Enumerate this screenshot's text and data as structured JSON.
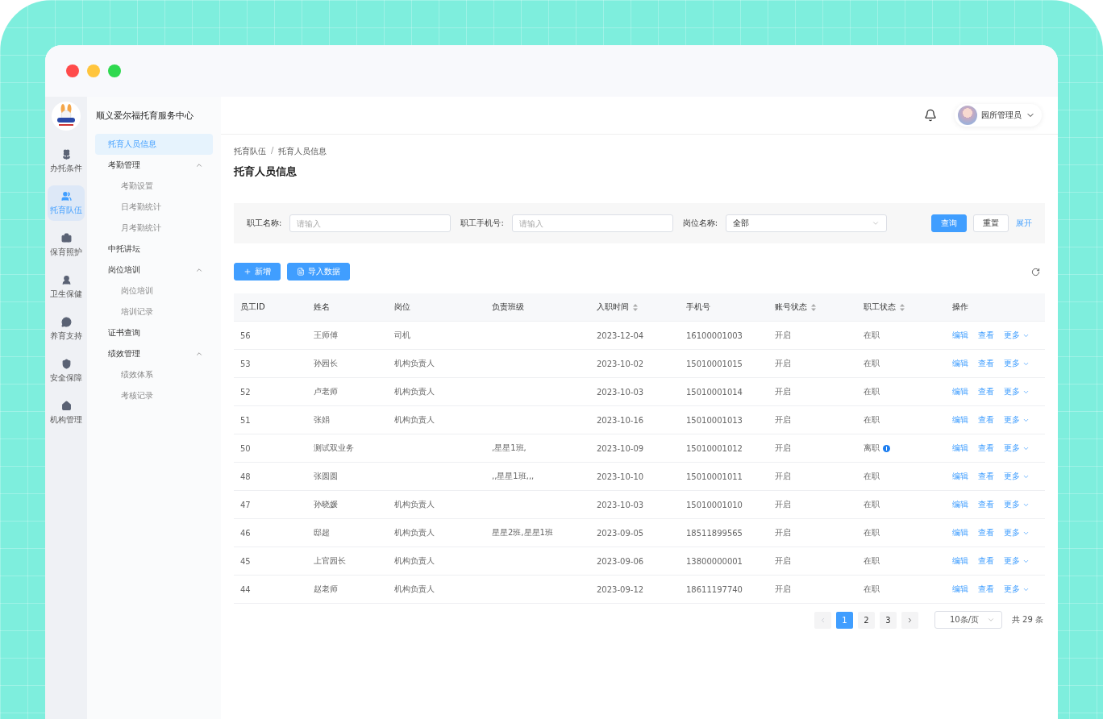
{
  "rail": [
    {
      "label": "办托条件",
      "selected": false
    },
    {
      "label": "托育队伍",
      "selected": true
    },
    {
      "label": "保育照护",
      "selected": false
    },
    {
      "label": "卫生保健",
      "selected": false
    },
    {
      "label": "养育支持",
      "selected": false
    },
    {
      "label": "安全保障",
      "selected": false
    },
    {
      "label": "机构管理",
      "selected": false
    }
  ],
  "org_title": "顺义爱尔福托育服务中心",
  "nav": [
    {
      "label": "托育人员信息",
      "selected": true
    },
    {
      "label": "考勤管理",
      "expanded": true,
      "selected": false,
      "children": [
        {
          "label": "考勤设置",
          "selected": false
        },
        {
          "label": "日考勤统计",
          "selected": false
        },
        {
          "label": "月考勤统计",
          "selected": false
        }
      ]
    },
    {
      "label": "中托讲坛",
      "selected": false
    },
    {
      "label": "岗位培训",
      "expanded": true,
      "selected": false,
      "children": [
        {
          "label": "岗位培训",
          "selected": false
        },
        {
          "label": "培训记录",
          "selected": false
        }
      ]
    },
    {
      "label": "证书查询",
      "selected": false
    },
    {
      "label": "绩效管理",
      "expanded": true,
      "selected": false,
      "children": [
        {
          "label": "绩效体系",
          "selected": false
        },
        {
          "label": "考核记录",
          "selected": false
        }
      ]
    }
  ],
  "user": {
    "name": "园所管理员"
  },
  "breadcrumb": [
    "托育队伍",
    "/",
    "托育人员信息"
  ],
  "page_title": "托育人员信息",
  "filters": [
    {
      "label": "职工名称:",
      "kind": "input",
      "placeholder": "请输入"
    },
    {
      "label": "职工手机号:",
      "kind": "input",
      "placeholder": "请输入"
    },
    {
      "label": "岗位名称:",
      "kind": "select",
      "value": "全部"
    }
  ],
  "filter_buttons": {
    "query": "查询",
    "reset": "重置",
    "expand": "展开"
  },
  "toolbar": {
    "add": "新增",
    "import": "导入数据"
  },
  "table": {
    "columns": [
      {
        "label": "员工ID",
        "sortable": false
      },
      {
        "label": "姓名",
        "sortable": false
      },
      {
        "label": "岗位",
        "sortable": false
      },
      {
        "label": "负责班级",
        "sortable": false
      },
      {
        "label": "入职时间",
        "sortable": true
      },
      {
        "label": "手机号",
        "sortable": false
      },
      {
        "label": "账号状态",
        "sortable": true
      },
      {
        "label": "职工状态",
        "sortable": true
      },
      {
        "label": "操作",
        "sortable": false
      }
    ],
    "rows": [
      {
        "cells": [
          "56",
          "王师傅",
          "司机",
          "",
          "2023-12-04",
          "16100001003",
          "开启",
          "在职"
        ],
        "info": false,
        "actions": [
          "编辑",
          "查看",
          "更多"
        ]
      },
      {
        "cells": [
          "53",
          "孙园长",
          "机构负责人",
          "",
          "2023-10-02",
          "15010001015",
          "开启",
          "在职"
        ],
        "info": false,
        "actions": [
          "编辑",
          "查看",
          "更多"
        ]
      },
      {
        "cells": [
          "52",
          "卢老师",
          "机构负责人",
          "",
          "2023-10-03",
          "15010001014",
          "开启",
          "在职"
        ],
        "info": false,
        "actions": [
          "编辑",
          "查看",
          "更多"
        ]
      },
      {
        "cells": [
          "51",
          "张娟",
          "机构负责人",
          "",
          "2023-10-16",
          "15010001013",
          "开启",
          "在职"
        ],
        "info": false,
        "actions": [
          "编辑",
          "查看",
          "更多"
        ]
      },
      {
        "cells": [
          "50",
          "测试双业务",
          "",
          ",星星1班,",
          "2023-10-09",
          "15010001012",
          "开启",
          "离职"
        ],
        "info": true,
        "actions": [
          "编辑",
          "查看",
          "更多"
        ]
      },
      {
        "cells": [
          "48",
          "张圆圆",
          "",
          ",,星星1班,,,",
          "2023-10-10",
          "15010001011",
          "开启",
          "在职"
        ],
        "info": false,
        "actions": [
          "编辑",
          "查看",
          "更多"
        ]
      },
      {
        "cells": [
          "47",
          "孙晓媛",
          "机构负责人",
          "",
          "2023-10-03",
          "15010001010",
          "开启",
          "在职"
        ],
        "info": false,
        "actions": [
          "编辑",
          "查看",
          "更多"
        ]
      },
      {
        "cells": [
          "46",
          "邸超",
          "机构负责人",
          "星星2班,星星1班",
          "2023-09-05",
          "18511899565",
          "开启",
          "在职"
        ],
        "info": false,
        "actions": [
          "编辑",
          "查看",
          "更多"
        ]
      },
      {
        "cells": [
          "45",
          "上官园长",
          "机构负责人",
          "",
          "2023-09-06",
          "13800000001",
          "开启",
          "在职"
        ],
        "info": false,
        "actions": [
          "编辑",
          "查看",
          "更多"
        ]
      },
      {
        "cells": [
          "44",
          "赵老师",
          "机构负责人",
          "",
          "2023-09-12",
          "18611197740",
          "开启",
          "在职"
        ],
        "info": false,
        "actions": [
          "编辑",
          "查看",
          "更多"
        ]
      }
    ]
  },
  "pagination": {
    "prev_disabled": true,
    "pages": [
      {
        "label": "1",
        "selected": true
      },
      {
        "label": "2",
        "selected": false
      },
      {
        "label": "3",
        "selected": false
      }
    ],
    "page_size": "10条/页",
    "total": "共 29 条"
  }
}
